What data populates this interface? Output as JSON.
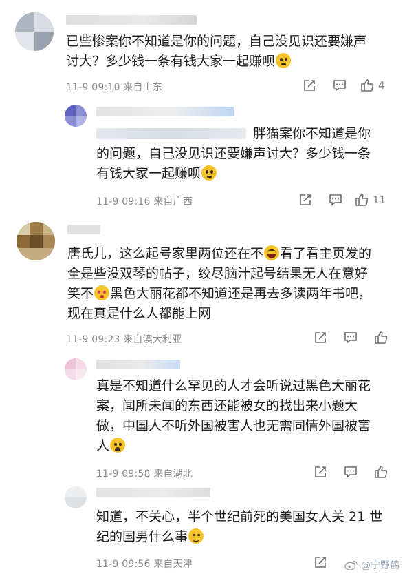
{
  "comments": [
    {
      "text_parts": [
        "已些惨案你不知道是你的问题，自己没见识还要嫌声讨大？多少钱一条有钱大家一起赚呗"
      ],
      "emoji": "thinking-face",
      "time": "11-9 09:10",
      "location": "来自山东",
      "likes": "4"
    },
    {
      "text_parts": [
        "胖猫案你不知道是你的问题，自己没见识还要嫌声讨大？多少钱一条有钱大家一起赚呗"
      ],
      "emoji": "thinking-face",
      "time": "11-9 09:16",
      "location": "来自广西",
      "likes": "11"
    },
    {
      "text_parts": [
        "唐氏儿，这么起号家里两位还在不",
        "看了看主页发的全是些没双琴的帖子，绞尽脑汁起号结果无人在意好笑不",
        "黑色大丽花都不知道还是再去多读两年书吧，现在真是什么人都能上网"
      ],
      "emoji": [
        "grinning-squinting-face",
        "kissing-face"
      ],
      "time": "11-9 09:23",
      "location": "来自澳大利亚",
      "likes": ""
    },
    {
      "text_parts": [
        "真是不知道什么罕见的人才会听说过黑色大丽花案，闻所未闻的东西还能被女的找出来小题大做，中国人不听外国被害人也无需同情外国被害人"
      ],
      "emoji": "sad-face",
      "time": "11-9 09:58",
      "location": "来自湖北",
      "likes": ""
    },
    {
      "text_parts": [
        "知道，不关心，半个世纪前死的美国女人关21世纪的国男什么事"
      ],
      "emoji": "smiling-face",
      "time": "11-9 09:56",
      "location": "来自天津",
      "likes": ""
    }
  ],
  "lines": {
    "c1": [
      "已些惨案你不知道是你的问题，自己没见识还要嫌声",
      "讨大？多少钱一条有钱大家一起赚呗"
    ],
    "c2": [
      "胖猫案你不知道是你",
      "的问题，自己没见识还要嫌声讨大？多少钱一条",
      "有钱大家一起赚呗"
    ],
    "c3": [
      "唐氏儿，这么起号家里两位还在不",
      "看了看主页发的",
      "全是些没双琴的帖子，绞尽脑汁起号结果无人在意好",
      "笑不",
      "黑色大丽花都不知道还是再去多读两年书吧，",
      "现在真是什么人都能上网"
    ],
    "c4": [
      "真是不知道什么罕见的人才会听说过黑色大丽花",
      "案，闻所未闻的东西还能被女的找出来小题大",
      "做，中国人不听外国被害人也无需同情外国被害",
      "人"
    ],
    "c5": [
      "知道，不关心，半个世纪前死的美国女人关 21 世",
      "纪的国男什么事"
    ]
  },
  "icons": {
    "share": "share-icon",
    "comment": "comment-icon",
    "like": "like-icon",
    "watermark": "weibo-logo-icon"
  },
  "colors": {
    "meta": "#8c8c8c",
    "text": "#1f1f1f",
    "icon": "#6f6f6f"
  },
  "watermark": {
    "handle": "@宁野鹤"
  }
}
